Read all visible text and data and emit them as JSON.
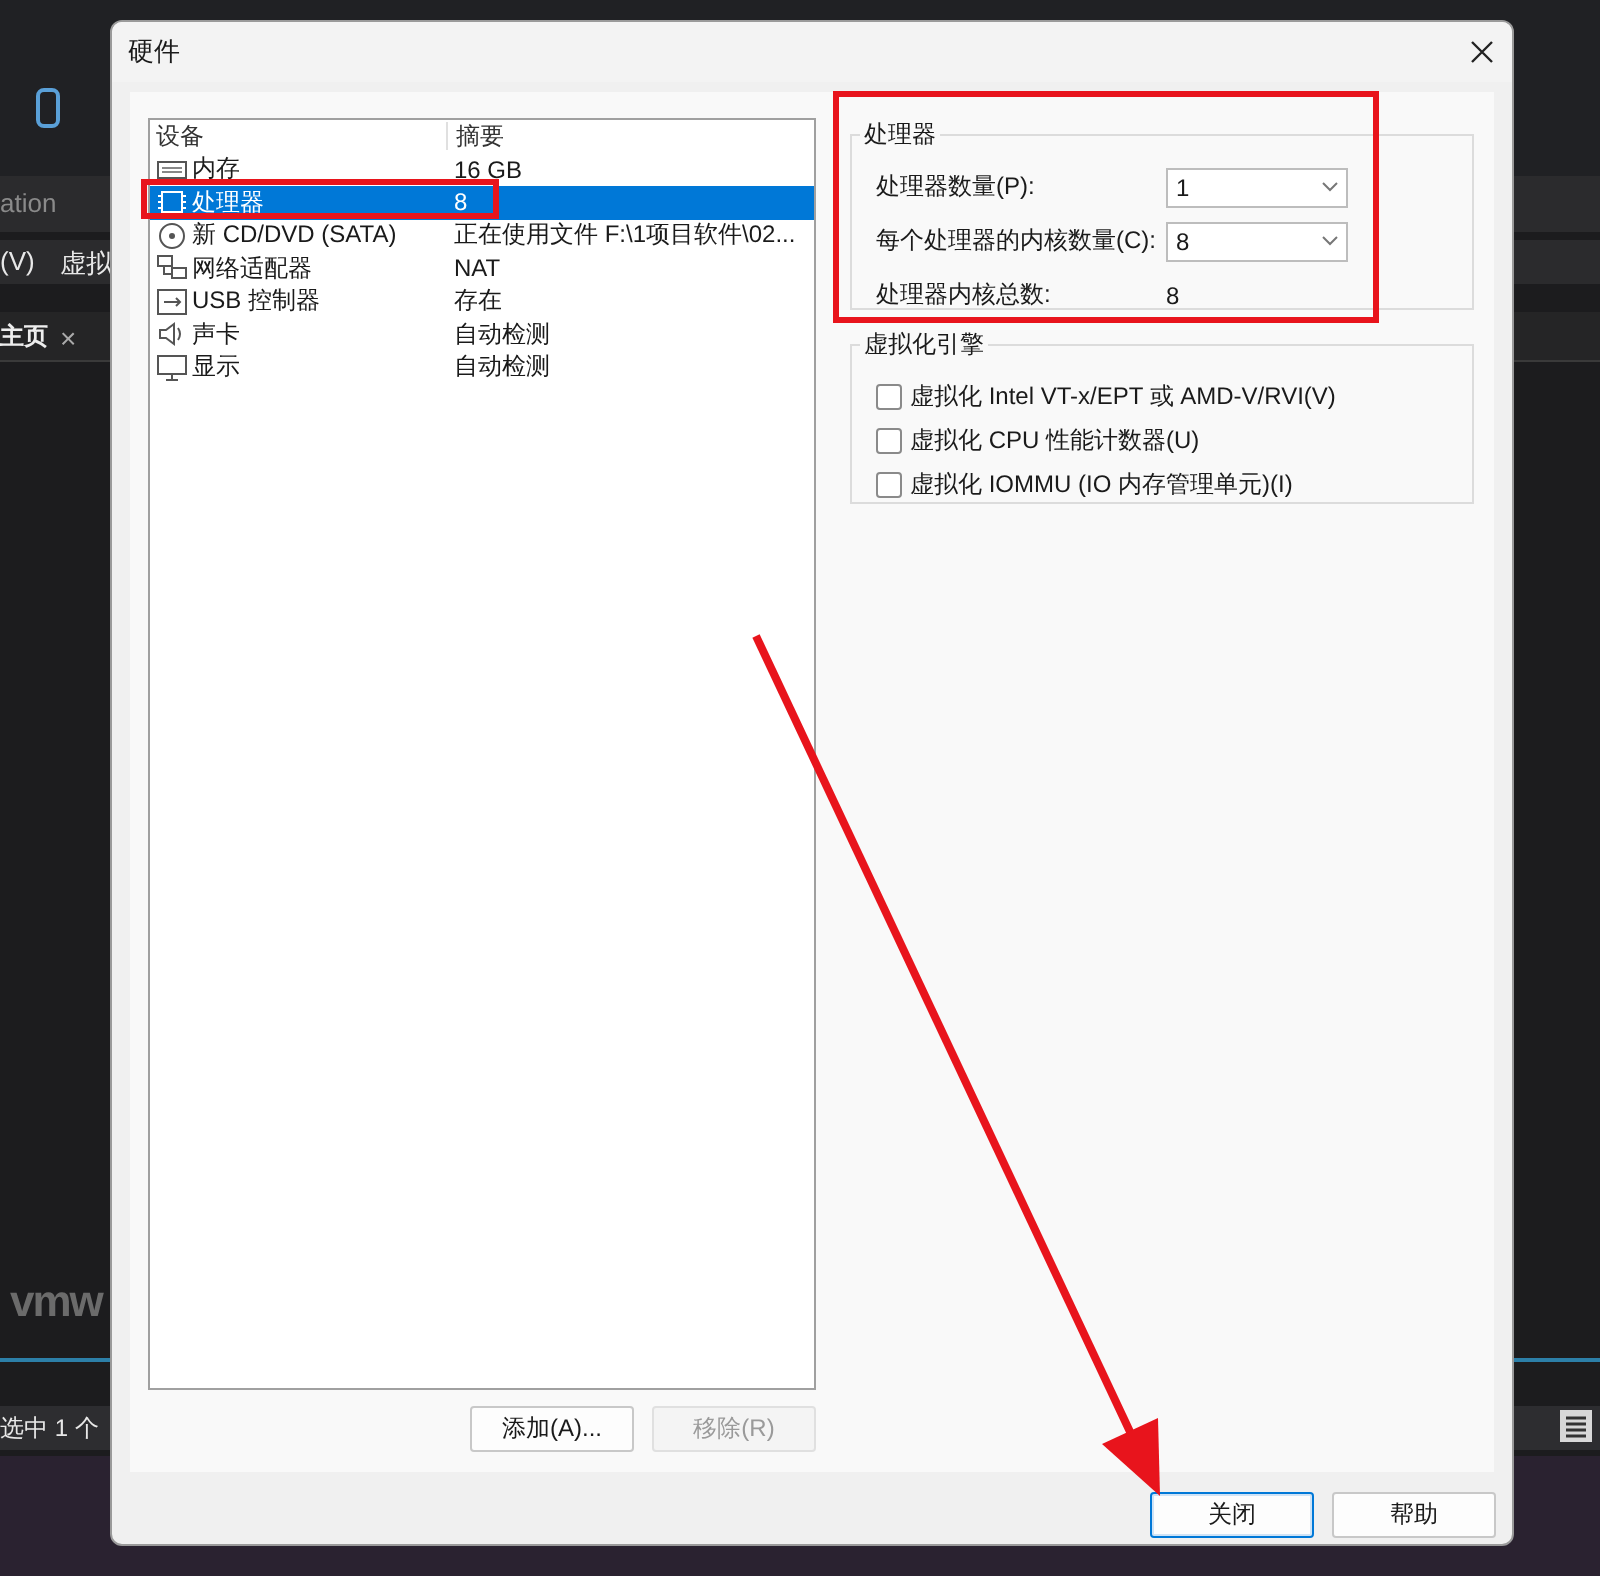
{
  "background_app": {
    "title_fragment": "ation",
    "menu": [
      "(V)",
      "虚拟"
    ],
    "tab": {
      "label": "主页",
      "close": "×"
    },
    "logo_fragment": "vmw",
    "status_fragment": "选中 1 个"
  },
  "window": {
    "title": "硬件"
  },
  "devices": {
    "columns": [
      "设备",
      "摘要"
    ],
    "rows": [
      {
        "kind": "memory",
        "name": "内存",
        "summary": "16 GB",
        "selected": false
      },
      {
        "kind": "cpu",
        "name": "处理器",
        "summary": "8",
        "selected": true
      },
      {
        "kind": "cd",
        "name": "新 CD/DVD (SATA)",
        "summary": "正在使用文件 F:\\1项目软件\\02...",
        "selected": false
      },
      {
        "kind": "network",
        "name": "网络适配器",
        "summary": "NAT",
        "selected": false
      },
      {
        "kind": "usb",
        "name": "USB 控制器",
        "summary": "存在",
        "selected": false
      },
      {
        "kind": "sound",
        "name": "声卡",
        "summary": "自动检测",
        "selected": false
      },
      {
        "kind": "display",
        "name": "显示",
        "summary": "自动检测",
        "selected": false
      }
    ],
    "buttons": [
      {
        "label": "添加(A)...",
        "disabled": false
      },
      {
        "label": "移除(R)",
        "disabled": true
      }
    ]
  },
  "processor": {
    "title": "处理器",
    "fields": [
      {
        "label": "处理器数量(P):",
        "value": "1"
      },
      {
        "label": "每个处理器的内核数量(C):",
        "value": "8"
      }
    ],
    "total": {
      "label": "处理器内核总数:",
      "value": "8"
    }
  },
  "virtualization": {
    "title": "虚拟化引擎",
    "options": [
      {
        "label": "虚拟化 Intel VT-x/EPT 或 AMD-V/RVI(V)",
        "checked": false
      },
      {
        "label": "虚拟化 CPU 性能计数器(U)",
        "checked": false
      },
      {
        "label": "虚拟化 IOMMU (IO 内存管理单元)(I)",
        "checked": false
      }
    ]
  },
  "footer_buttons": [
    {
      "label": "关闭",
      "focused": true
    },
    {
      "label": "帮助",
      "focused": false
    }
  ],
  "annotations": [
    {
      "kind": "row_box"
    },
    {
      "kind": "group_box"
    },
    {
      "kind": "arrow"
    }
  ]
}
